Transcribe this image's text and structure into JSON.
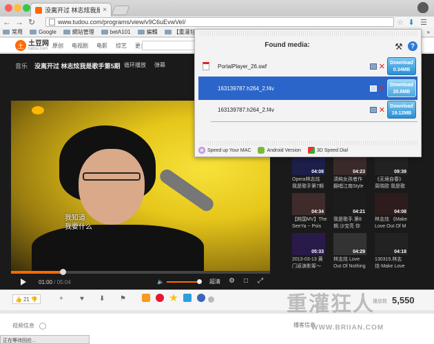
{
  "browser": {
    "tab_title": "没离开过 林志炫我是歌手第…",
    "tab_close": "×",
    "url": "www.tudou.com/programs/view/v9C6uEvwVeI/",
    "bookmarks": [
      "常用",
      "Google",
      "網站管理",
      "betA101",
      "編輯",
      "【重灌狂人】",
      "»"
    ]
  },
  "site": {
    "logo_text": "土豆网",
    "logo_sub": "tudou.com",
    "nav": [
      "原创",
      "电视剧",
      "电影",
      "综艺",
      "更多"
    ]
  },
  "player": {
    "breadcrumb": "音乐",
    "title": "没离开过 林志炫我是歌手第5期",
    "controls": [
      "循环播放",
      "弹幕"
    ],
    "subtitle_lines": [
      "我知道",
      "我要什么"
    ],
    "time_current": "01:00",
    "time_total": "05:04",
    "quality": "超清",
    "progress": 0.2,
    "volume": 0.8
  },
  "extension": {
    "title": "Found media:",
    "items": [
      {
        "name": "PortalPlayer_26.swf",
        "button_label": "Download",
        "size": "0.34MB",
        "selected": false
      },
      {
        "name": "163139787.h264_2.f4v",
        "button_label": "Download",
        "size": "20.6MB",
        "selected": true
      },
      {
        "name": "163139787.h264_2.f4v",
        "button_label": "Download",
        "size": "19.12MB",
        "selected": false
      }
    ],
    "footer": [
      "Speed up Your MAC",
      "Android Version",
      "3D Speed Dial"
    ]
  },
  "sidebar_videos": [
    {
      "duration": "04:08",
      "caption": ""
    },
    {
      "duration": "04:23",
      "caption": ""
    },
    {
      "duration": "09:39",
      "caption": ""
    },
    {
      "duration": "",
      "caption": "Opera林志炫"
    },
    {
      "duration": "",
      "caption": "清純女孩者作"
    },
    {
      "duration": "",
      "caption": "《无境自春》"
    },
    {
      "duration": "",
      "caption": "我是歌手第7期"
    },
    {
      "duration": "",
      "caption": "翻唱江南Style"
    },
    {
      "duration": "",
      "caption": "周晓欧 我是歌"
    },
    {
      "duration": "04:34",
      "caption": "【韩国MV】The"
    },
    {
      "duration": "04:21",
      "caption": "我是歌手.第8"
    },
    {
      "duration": "04:08",
      "caption": "林志炫 《Make"
    },
    {
      "duration": "",
      "caption": "SeeYa ~ Pois"
    },
    {
      "duration": "",
      "caption": "期.沙宝亮 你"
    },
    {
      "duration": "",
      "caption": "Love Out Of M"
    },
    {
      "duration": "05:33",
      "caption": "2013-03-13 黄"
    },
    {
      "duration": "04:29",
      "caption": "林志炫 Love"
    },
    {
      "duration": "04:18",
      "caption": "130315.林志"
    },
    {
      "duration": "",
      "caption": "门返演影筹～"
    },
    {
      "duration": "",
      "caption": "Out Of Nothing"
    },
    {
      "duration": "",
      "caption": "炫-Make Love"
    }
  ],
  "actions": {
    "like_count": "21",
    "views_label": "播放数",
    "views": "5,550",
    "info_title": "视频信息",
    "bloggers": "播客信息"
  },
  "status_text": "正在等待回应...",
  "watermark": {
    "text": "重灌狂人",
    "url": "WWW.BRIIAN.COM"
  },
  "colors": {
    "selected_row": "#2c65c9",
    "download_button": "#2a8fd3",
    "tudou_orange": "#ff6a00"
  }
}
